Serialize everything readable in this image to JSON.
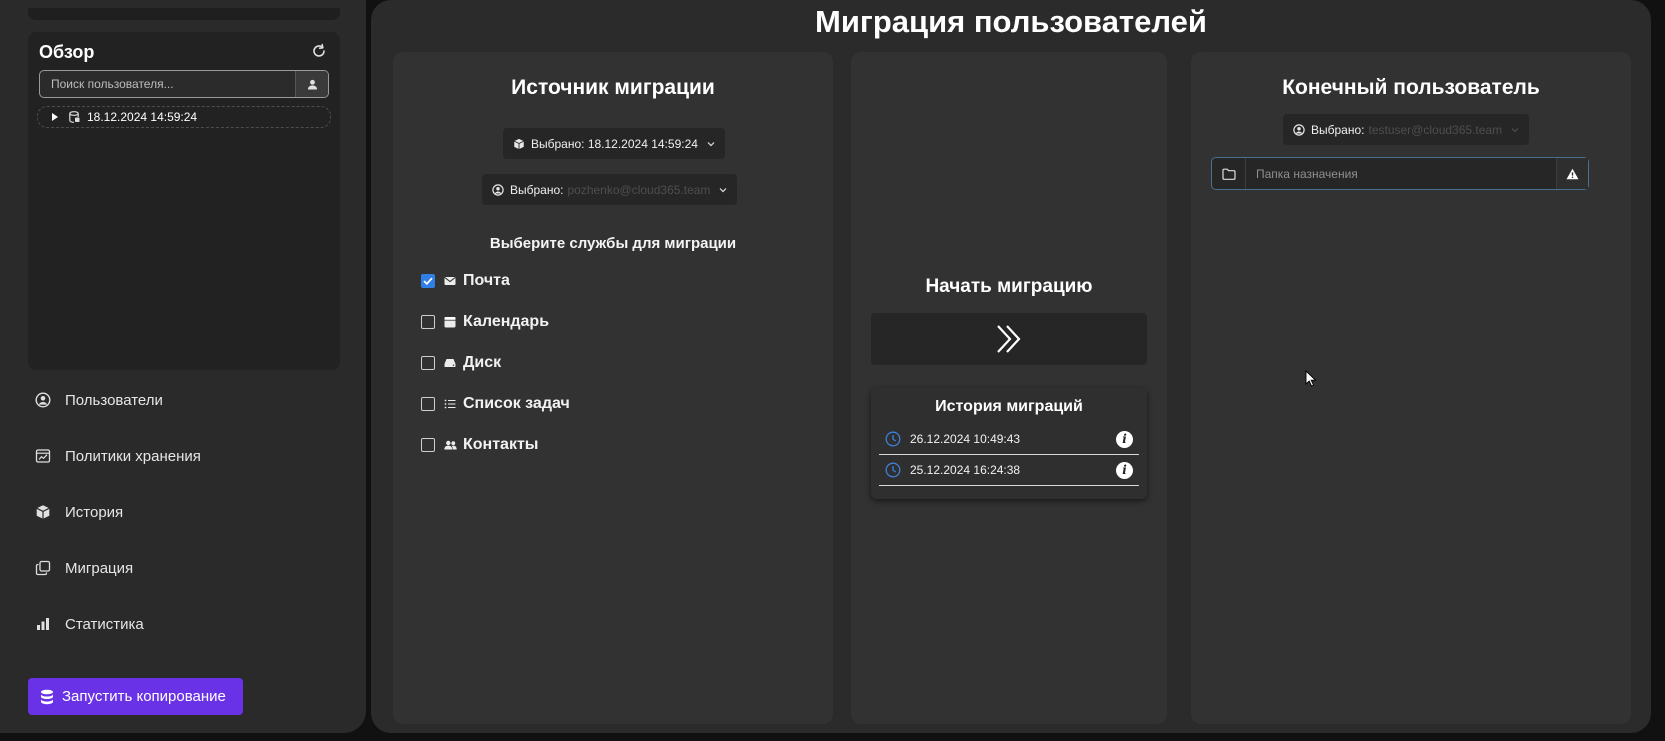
{
  "sidebar": {
    "overview_title": "Обзор",
    "search_placeholder": "Поиск пользователя...",
    "tree_item": "18.12.2024 14:59:24",
    "nav": [
      {
        "label": "Пользователи",
        "icon": "user-circle-icon"
      },
      {
        "label": "Политики хранения",
        "icon": "chart-window-icon"
      },
      {
        "label": "История",
        "icon": "box-icon"
      },
      {
        "label": "Миграция",
        "icon": "copy-icon"
      },
      {
        "label": "Статистика",
        "icon": "bar-chart-icon"
      }
    ],
    "run_button": "Запустить копирование"
  },
  "main": {
    "title": "Миграция пользователей",
    "source": {
      "title": "Источник миграции",
      "snapshot_dropdown": "Выбрано: 18.12.2024 14:59:24",
      "user_dropdown_label": "Выбрано:",
      "user_dropdown_value": "pozhenko@cloud365.team",
      "services_title": "Выберите службы для миграции",
      "services": [
        {
          "label": "Почта",
          "checked": true,
          "icon": "mail-icon"
        },
        {
          "label": "Календарь",
          "checked": false,
          "icon": "calendar-icon"
        },
        {
          "label": "Диск",
          "checked": false,
          "icon": "drive-icon"
        },
        {
          "label": "Список задач",
          "checked": false,
          "icon": "list-icon"
        },
        {
          "label": "Контакты",
          "checked": false,
          "icon": "contacts-icon"
        }
      ]
    },
    "start": {
      "title": "Начать миграцию",
      "history_title": "История миграций",
      "history": [
        {
          "time": "26.12.2024 10:49:43"
        },
        {
          "time": "25.12.2024 16:24:38"
        }
      ],
      "info_glyph": "i"
    },
    "dest": {
      "title": "Конечный пользователь",
      "user_dropdown_label": "Выбрано:",
      "user_dropdown_value": "testuser@cloud365.team",
      "folder_placeholder": "Папка назначения"
    }
  },
  "colors": {
    "accent_purple": "#6a32e6",
    "checkbox_blue": "#2f7fe5",
    "clock_blue": "#3f7fd8"
  }
}
